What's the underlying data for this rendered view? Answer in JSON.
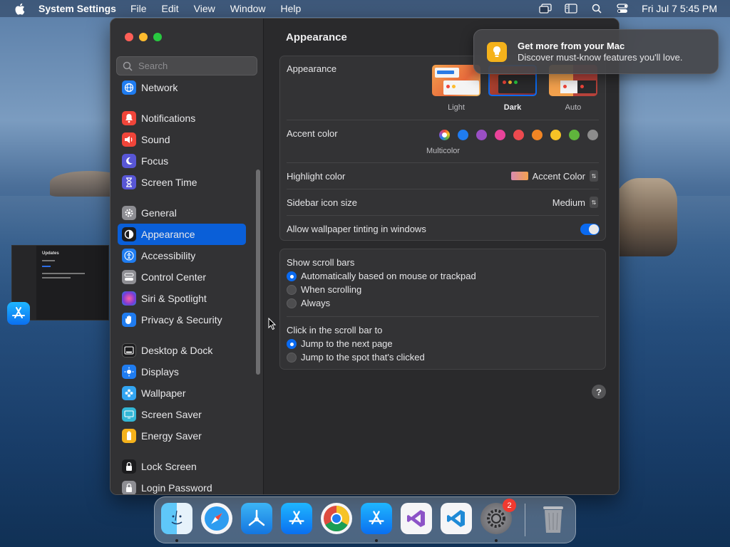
{
  "menubar": {
    "app_name": "System Settings",
    "menus": [
      "File",
      "Edit",
      "View",
      "Window",
      "Help"
    ],
    "datetime": "Fri Jul 7  5:45 PM"
  },
  "sidebar": {
    "search_placeholder": "Search",
    "items": [
      {
        "label": "Network",
        "icon": "globe-icon",
        "color": "#1f7cf0"
      },
      {
        "label": "Notifications",
        "icon": "bell-icon",
        "color": "#f0453a"
      },
      {
        "label": "Sound",
        "icon": "speaker-icon",
        "color": "#f0453a"
      },
      {
        "label": "Focus",
        "icon": "moon-icon",
        "color": "#5856d6"
      },
      {
        "label": "Screen Time",
        "icon": "hourglass-icon",
        "color": "#5856d6"
      },
      {
        "label": "General",
        "icon": "gear-icon",
        "color": "#8e8e93"
      },
      {
        "label": "Appearance",
        "icon": "appearance-icon",
        "color": "#1c1c1e"
      },
      {
        "label": "Accessibility",
        "icon": "accessibility-icon",
        "color": "#1f7cf0"
      },
      {
        "label": "Control Center",
        "icon": "control-center-icon",
        "color": "#8e8e93"
      },
      {
        "label": "Siri & Spotlight",
        "icon": "siri-icon",
        "color": "#c43bd6"
      },
      {
        "label": "Privacy & Security",
        "icon": "hand-icon",
        "color": "#1f7cf0"
      },
      {
        "label": "Desktop & Dock",
        "icon": "dock-icon",
        "color": "#1c1c1e"
      },
      {
        "label": "Displays",
        "icon": "sun-icon",
        "color": "#1f7cf0"
      },
      {
        "label": "Wallpaper",
        "icon": "flower-icon",
        "color": "#33a5f2"
      },
      {
        "label": "Screen Saver",
        "icon": "screen-saver-icon",
        "color": "#33b7d6"
      },
      {
        "label": "Energy Saver",
        "icon": "battery-icon",
        "color": "#f5b21b"
      },
      {
        "label": "Lock Screen",
        "icon": "lock-icon",
        "color": "#1c1c1e"
      },
      {
        "label": "Login Password",
        "icon": "key-lock-icon",
        "color": "#8e8e93"
      }
    ],
    "active": "Appearance"
  },
  "content": {
    "title": "Appearance",
    "appearance": {
      "label": "Appearance",
      "options": [
        "Light",
        "Dark",
        "Auto"
      ],
      "selected": "Dark"
    },
    "accent": {
      "label": "Accent color",
      "caption": "Multicolor",
      "colors": [
        "multicolor",
        "#1f7cf0",
        "#9a4fc4",
        "#e9439a",
        "#ec4a4f",
        "#f28524",
        "#f6c326",
        "#5fb53c",
        "#8c8c8c"
      ]
    },
    "highlight": {
      "label": "Highlight color",
      "value": "Accent Color"
    },
    "sidebar_icon_size": {
      "label": "Sidebar icon size",
      "value": "Medium"
    },
    "wallpaper_tinting": {
      "label": "Allow wallpaper tinting in windows",
      "on": true
    },
    "scroll_bars": {
      "label": "Show scroll bars",
      "options": [
        "Automatically based on mouse or trackpad",
        "When scrolling",
        "Always"
      ],
      "selected": 0
    },
    "click_scroll": {
      "label": "Click in the scroll bar to",
      "options": [
        "Jump to the next page",
        "Jump to the spot that's clicked"
      ],
      "selected": 0
    },
    "help": "?"
  },
  "notification": {
    "title": "Get more from your Mac",
    "body": "Discover must-know features you'll love."
  },
  "ghost_window": {
    "title": "Updates"
  },
  "dock": {
    "apps": [
      "Finder",
      "Safari",
      "Xcode Instruments",
      "App Store",
      "Chrome",
      "App Store",
      "Visual Studio",
      "VS Code",
      "System Settings",
      "Trash"
    ],
    "settings_badge": "2"
  }
}
